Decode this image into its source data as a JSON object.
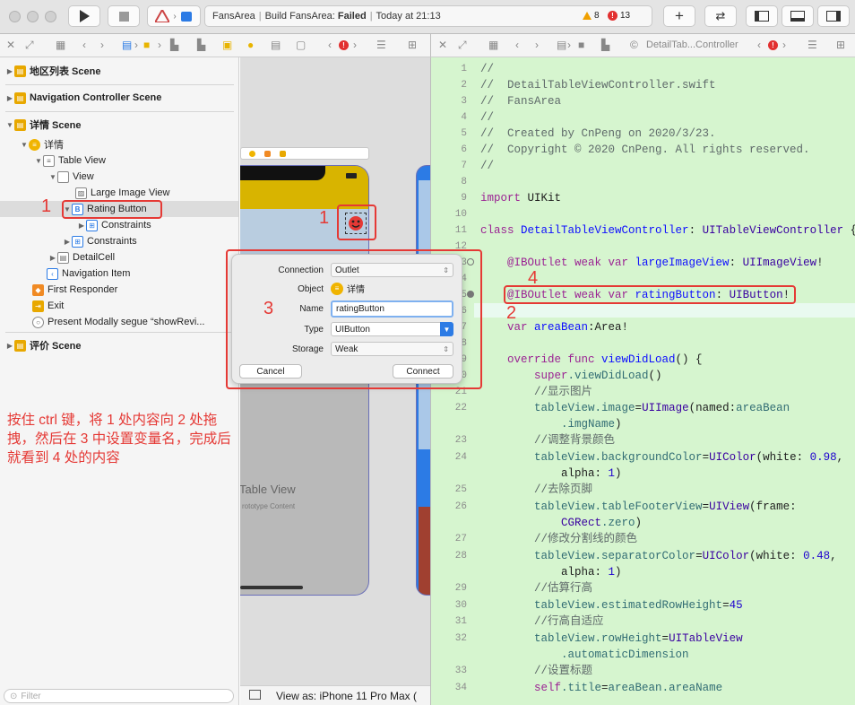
{
  "toolbar": {
    "activity_app": "FansArea",
    "activity_build": "Build FansArea:",
    "activity_status": "Failed",
    "activity_time": "Today at 21:13",
    "warnings": "8",
    "errors": "13"
  },
  "jumpbar_right": {
    "file": "DetailTab...Controller"
  },
  "navigator": {
    "items": [
      {
        "label": "地区列表 Scene"
      },
      {
        "label": "Navigation Controller Scene"
      },
      {
        "label": "详情 Scene"
      },
      {
        "label": "详情"
      },
      {
        "label": "Table View"
      },
      {
        "label": "View"
      },
      {
        "label": "Large Image View"
      },
      {
        "label": "Rating Button"
      },
      {
        "label": "Constraints"
      },
      {
        "label": "Constraints"
      },
      {
        "label": "DetailCell"
      },
      {
        "label": "Navigation Item"
      },
      {
        "label": "First Responder"
      },
      {
        "label": "Exit"
      },
      {
        "label": "Present Modally segue “showRevi..."
      },
      {
        "label": "评价 Scene"
      }
    ],
    "filter_placeholder": "Filter"
  },
  "canvas": {
    "table_view_label": "Table View",
    "prototype_label": "rototype Content",
    "view_as": "View as: iPhone 11 Pro Max ("
  },
  "popover": {
    "connection_label": "Connection",
    "connection_value": "Outlet",
    "object_label": "Object",
    "object_value": "详情",
    "name_label": "Name",
    "name_value": "ratingButton",
    "type_label": "Type",
    "type_value": "UIButton",
    "storage_label": "Storage",
    "storage_value": "Weak",
    "cancel": "Cancel",
    "connect": "Connect"
  },
  "annotations": {
    "n1": "1",
    "n1b": "1",
    "n2": "2",
    "n3": "3",
    "n4": "4",
    "note": "按住 ctrl 键，将 1 处内容向 2 处拖拽，然后在 3 中设置变量名，完成后就看到 4 处的内容"
  },
  "code": {
    "l1": "//",
    "l2": "//  DetailTableViewController.swift",
    "l3": "//  FansArea",
    "l4": "//",
    "l5": "//  Created by CnPeng on 2020/3/23.",
    "l6": "//  Copyright © 2020 CnPeng. All rights reserved.",
    "l7": "//",
    "l9a": "import",
    "l9b": " UIKit",
    "l11a": "class",
    "l11b": " DetailTableViewController",
    "l11c": ": ",
    "l11d": "UITableViewController",
    "l11e": " {",
    "l13a": "    @IBOutlet weak var",
    "l13b": " largeImageView",
    "l13c": ": ",
    "l13d": "UIImageView",
    "l13e": "!",
    "l14a": "    @IBOutlet weak var",
    "l14b": " ratingButton",
    "l14c": ": ",
    "l14d": "UIButton",
    "l14e": "!",
    "l16a": "    var",
    "l16b": " areaBean",
    "l16c": ":Area!",
    "l18a": "    override func",
    "l18b": " viewDidLoad",
    "l18c": "() {",
    "l19a": "        super",
    "l19b": ".viewDidLoad",
    "l19c": "()",
    "l20": "        //显示图片",
    "l21a": "        tableView",
    "l21b": ".image",
    "l21c": "=",
    "l21d": "UIImage",
    "l21e": "(named:",
    "l21f": "areaBean",
    "l21g": "            .imgName",
    "l21h": ")",
    "l23": "        //调整背景颜色",
    "l24a": "        tableView",
    "l24b": ".backgroundColor",
    "l24c": "=",
    "l24d": "UIColor",
    "l24e": "(white: ",
    "l24f": "0.98",
    "l24g": ",",
    "l24h": "            alpha: ",
    "l24i": "1",
    "l24j": ")",
    "l25": "        //去除页脚",
    "l26a": "        tableView",
    "l26b": ".tableFooterView",
    "l26c": "=",
    "l26d": "UIView",
    "l26e": "(frame:",
    "l26f": "            CGRect",
    "l26g": ".zero",
    "l26h": ")",
    "l27": "        //修改分割线的颜色",
    "l28a": "        tableView",
    "l28b": ".separatorColor",
    "l28c": "=",
    "l28d": "UIColor",
    "l28e": "(white: ",
    "l28f": "0.48",
    "l28g": ",",
    "l28h": "            alpha: ",
    "l28i": "1",
    "l28j": ")",
    "l29": "        //估算行高",
    "l30a": "        tableView",
    "l30b": ".estimatedRowHeight",
    "l30c": "=",
    "l30d": "45",
    "l31": "        //行高自适应",
    "l32a": "        tableView",
    "l32b": ".rowHeight",
    "l32c": "=",
    "l32d": "UITableView",
    "l32e": "            .automaticDimension",
    "l33": "        //设置标题",
    "l34a": "        self",
    "l34b": ".title",
    "l34c": "=",
    "l34d": "areaBean",
    "l34e": ".areaName"
  },
  "line_numbers": [
    "1",
    "2",
    "3",
    "4",
    "5",
    "6",
    "7",
    "8",
    "9",
    "10",
    "11",
    "12",
    "13",
    "14",
    "15",
    "16",
    "17",
    "18",
    "19",
    "20",
    "21",
    "22",
    "23",
    "24",
    "25",
    "26",
    "27",
    "28",
    "29",
    "30",
    "31",
    "32",
    "33",
    "34"
  ],
  "colors": {
    "accent_red": "#e53935",
    "editor_bg": "#d6f5cf",
    "selection": "#dcdcdc"
  }
}
